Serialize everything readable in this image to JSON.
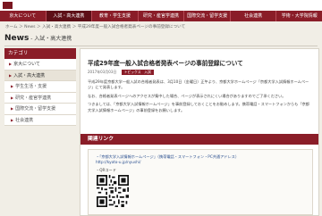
{
  "nav": {
    "items": [
      {
        "label": "京大について",
        "active": false
      },
      {
        "label": "入試・高大連携",
        "active": true
      },
      {
        "label": "教育・学生支援",
        "active": false
      },
      {
        "label": "研究・産官学連携",
        "active": false
      },
      {
        "label": "国際交流・留学支援",
        "active": false
      },
      {
        "label": "社会連携",
        "active": false
      },
      {
        "label": "学術・大学院情報",
        "active": false
      }
    ]
  },
  "breadcrumb": "ホーム ＞ News ＞ 入試・高大連携 ＞ 平成29年度一般入試合格者発表ページの事前登録について",
  "heading": {
    "eng": "News",
    "jp": " - 入試・高大連携"
  },
  "sidebar": {
    "header": "カテゴリ",
    "items": [
      {
        "label": "京大について",
        "active": false,
        "sub": false
      },
      {
        "label": "入試・高大連携",
        "active": true,
        "sub": false
      },
      {
        "label": "学生生活・支援",
        "active": false,
        "sub": true
      },
      {
        "label": "研究・産官学連携",
        "active": false,
        "sub": true
      },
      {
        "label": "国際交流・留学支援",
        "active": false,
        "sub": true
      },
      {
        "label": "社会連携",
        "active": false,
        "sub": true
      }
    ]
  },
  "article": {
    "title": "平成29年度一般入試合格者発表ページの事前登録について",
    "date": "2017年03月03日",
    "category": "トピックス　入試",
    "paragraphs": [
      "平成29年度京都大学一般入試の合格者発表は、3月10日（金曜日）正午より、京都大学ホームページ「京都大学入試情報ホームページ」にて発表します。",
      "なお、合格者発表ページへのアクセスが集中した場合、ページが表示されにくい場合がありますのでご了承ください。",
      "つきましては、「京都大学入試情報ホームページ」を事前登録しておくことをお勧めします。携帯電話・スマートフォンからも「京都大学入試情報ホームページ」の事前登録をお願いします。"
    ]
  },
  "related": {
    "header": "関連リンク",
    "link1": "・「京都大学入試情報ホームページ」（携帯電話・スマートフォン・PC共通アドレス）",
    "link2": "http://kyoto-u.jp/nyushi/",
    "qr_label": "・QRコード"
  },
  "colors": {
    "accent": "#8a1d28",
    "page_bg": "#f1eee6"
  }
}
